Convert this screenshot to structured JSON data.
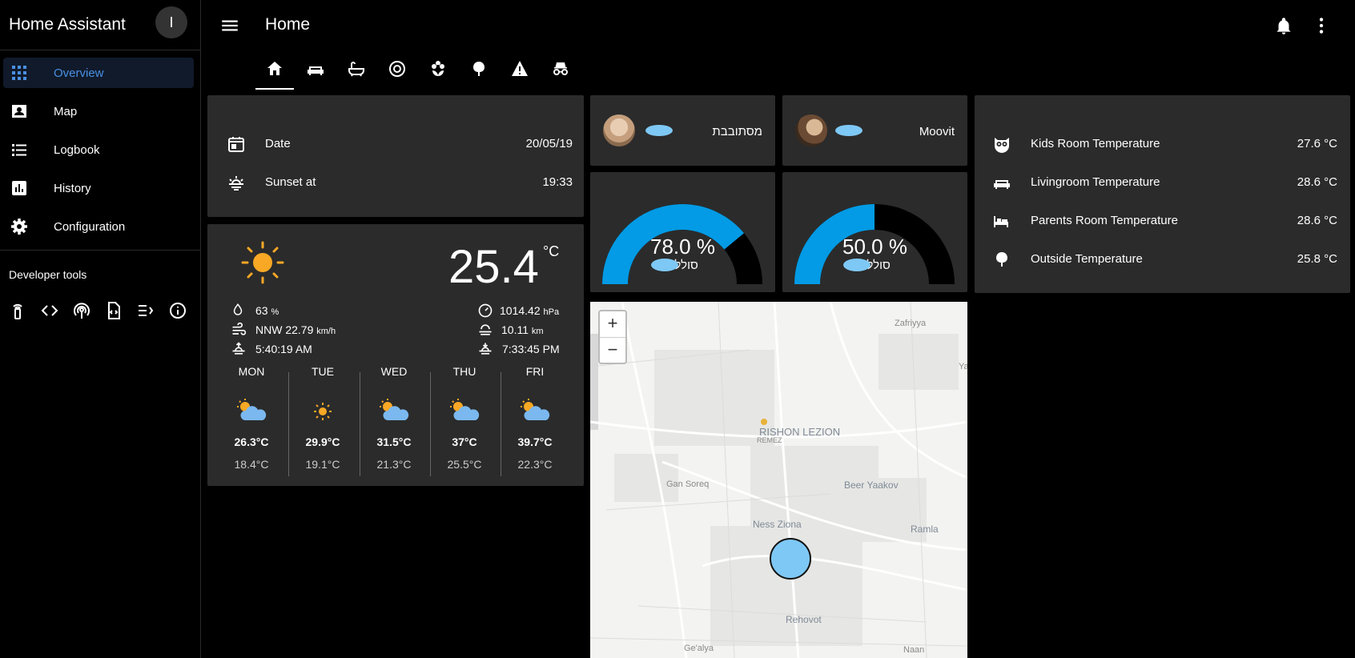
{
  "app": {
    "title": "Home Assistant",
    "avatar_initial": "I"
  },
  "sidebar": {
    "items": [
      {
        "label": "Overview",
        "icon": "view-dashboard-icon",
        "active": true
      },
      {
        "label": "Map",
        "icon": "account-box-icon",
        "active": false
      },
      {
        "label": "Logbook",
        "icon": "format-list-bulleted-icon",
        "active": false
      },
      {
        "label": "History",
        "icon": "chart-box-icon",
        "active": false
      },
      {
        "label": "Configuration",
        "icon": "settings-icon",
        "active": false
      }
    ],
    "developer_tools_title": "Developer tools",
    "developer_tools": [
      "remote-icon",
      "code-tags-icon",
      "access-point-icon",
      "file-xml-icon",
      "text-to-speech-icon",
      "information-outline-icon"
    ]
  },
  "toolbar": {
    "title": "Home"
  },
  "tabs": [
    "home-icon",
    "sofa-icon",
    "bathtub-icon",
    "robot-vacuum-icon",
    "flower-icon",
    "tree-icon",
    "alert-icon",
    "incognito-icon"
  ],
  "info_card": {
    "rows": [
      {
        "label": "Date",
        "value": "20/05/19",
        "icon": "calendar-icon"
      },
      {
        "label": "Sunset at",
        "value": "19:33",
        "icon": "weather-sunset-icon"
      }
    ]
  },
  "weather": {
    "temperature": "25.4",
    "unit": "°C",
    "humidity": "63",
    "humidity_unit": "%",
    "wind": "NNW 22.79",
    "wind_unit": "km/h",
    "sunrise": "5:40:19 AM",
    "pressure": "1014.42",
    "pressure_unit": "hPa",
    "visibility": "10.11",
    "visibility_unit": "km",
    "sunset": "7:33:45 PM",
    "forecast": [
      {
        "day": "MON",
        "high": "26.3°C",
        "low": "18.4°C",
        "icon": "partly-cloudy-icon"
      },
      {
        "day": "TUE",
        "high": "29.9°C",
        "low": "19.1°C",
        "icon": "sunny-icon"
      },
      {
        "day": "WED",
        "high": "31.5°C",
        "low": "21.3°C",
        "icon": "partly-cloudy-icon"
      },
      {
        "day": "THU",
        "high": "37°C",
        "low": "25.5°C",
        "icon": "partly-cloudy-icon"
      },
      {
        "day": "FRI",
        "high": "39.7°C",
        "low": "22.3°C",
        "icon": "partly-cloudy-icon"
      }
    ]
  },
  "people": [
    {
      "name": "מסתובבת"
    },
    {
      "name": "Moovit"
    }
  ],
  "gauges": [
    {
      "value": "78.0 %",
      "fraction": 0.78,
      "label": "סוללה"
    },
    {
      "value": "50.0 %",
      "fraction": 0.5,
      "label": "סוללה"
    }
  ],
  "temperatures": {
    "rows": [
      {
        "label": "Kids Room Temperature",
        "value": "27.6 °C",
        "icon": "owl-icon"
      },
      {
        "label": "Livingroom Temperature",
        "value": "28.6 °C",
        "icon": "sofa-icon"
      },
      {
        "label": "Parents Room Temperature",
        "value": "28.6 °C",
        "icon": "bed-icon"
      },
      {
        "label": "Outside Temperature",
        "value": "25.8 °C",
        "icon": "tree-icon"
      }
    ]
  },
  "map": {
    "zoom_in": "+",
    "zoom_out": "−",
    "labels": [
      "Zafriyya",
      "Ya",
      "RISHON LEZION",
      "REMEZ",
      "Gan Soreq",
      "Beer Yaakov",
      "Ness Ziona",
      "Ramla",
      "Rehovot",
      "Ge'alya",
      "Naan"
    ]
  },
  "colors": {
    "accent": "#039be5",
    "card": "#2b2b2b",
    "background": "#000000",
    "sun": "#f9a825",
    "active_nav": "#4a90e2"
  }
}
